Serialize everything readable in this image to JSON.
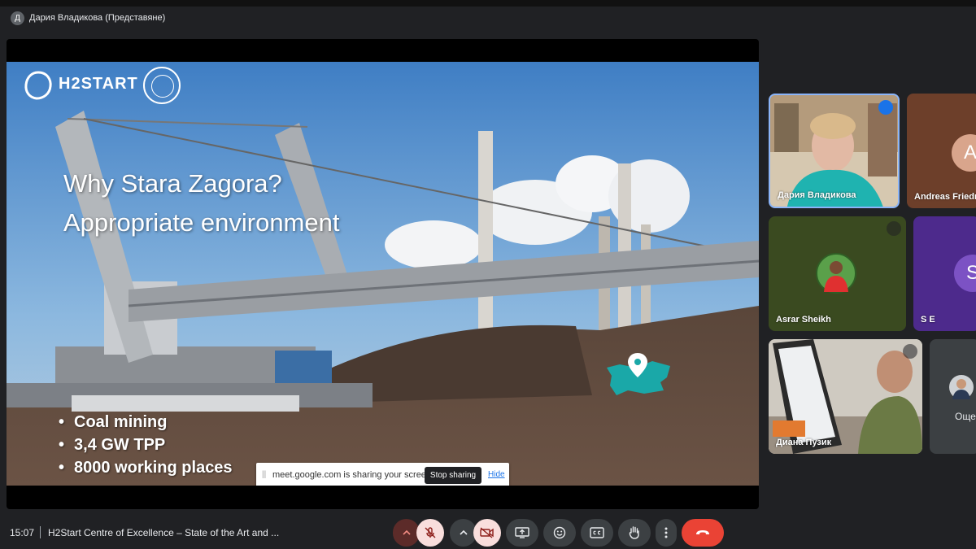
{
  "presenter": {
    "avatar_initial": "Д",
    "title": "Дария Владикова (Представяне)"
  },
  "slide": {
    "logo_text": "H2START",
    "title_line1": "Why Stara Zagora?",
    "title_line2": "Appropriate environment",
    "bullets": [
      "Coal mining",
      "3,4 GW TPP",
      "8000 working places"
    ],
    "map_color": "#1aa8a8"
  },
  "share_bar": {
    "message": "meet.google.com is sharing your screen.",
    "stop_label": "Stop sharing",
    "hide_label": "Hide"
  },
  "participants": [
    {
      "name": "Дария Владикова",
      "speaking": true
    },
    {
      "name": "Andreas Friedr",
      "initial": "A"
    },
    {
      "name": "Asrar Sheikh",
      "muted": true
    },
    {
      "name": "S E",
      "initial": "S"
    },
    {
      "name": "Диана Пузик",
      "muted": true
    },
    {
      "name": "Още",
      "initial": ""
    }
  ],
  "toolbar": {
    "time": "15:07",
    "meeting_title": "H2Start Centre of Excellence – State of the Art and ...",
    "mic_icon": "mic-off-icon",
    "camera_icon": "camera-off-icon",
    "present_icon": "present-screen-icon",
    "emoji_icon": "emoji-icon",
    "captions_icon": "captions-icon",
    "hand_icon": "raise-hand-icon",
    "more_icon": "more-options-icon",
    "leave_icon": "end-call-icon",
    "leave_color": "#ea4335"
  }
}
